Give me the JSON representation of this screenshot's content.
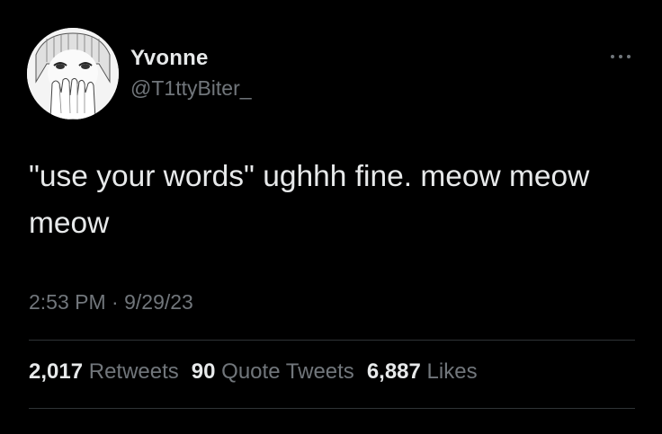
{
  "user": {
    "display_name": "Yvonne",
    "handle": "@T1ttyBiter_"
  },
  "tweet": {
    "text": "\"use your words\" ughhh fine. meow meow meow",
    "time": "2:53 PM",
    "separator": "·",
    "date": "9/29/23"
  },
  "stats": {
    "retweets_count": "2,017",
    "retweets_label": "Retweets",
    "quotes_count": "90",
    "quotes_label": "Quote Tweets",
    "likes_count": "6,887",
    "likes_label": "Likes"
  },
  "icons": {
    "more": "more-options-icon"
  },
  "colors": {
    "background": "#000000",
    "primary_text": "#e7e9ea",
    "secondary_text": "#71767b",
    "divider": "#2f3336"
  }
}
